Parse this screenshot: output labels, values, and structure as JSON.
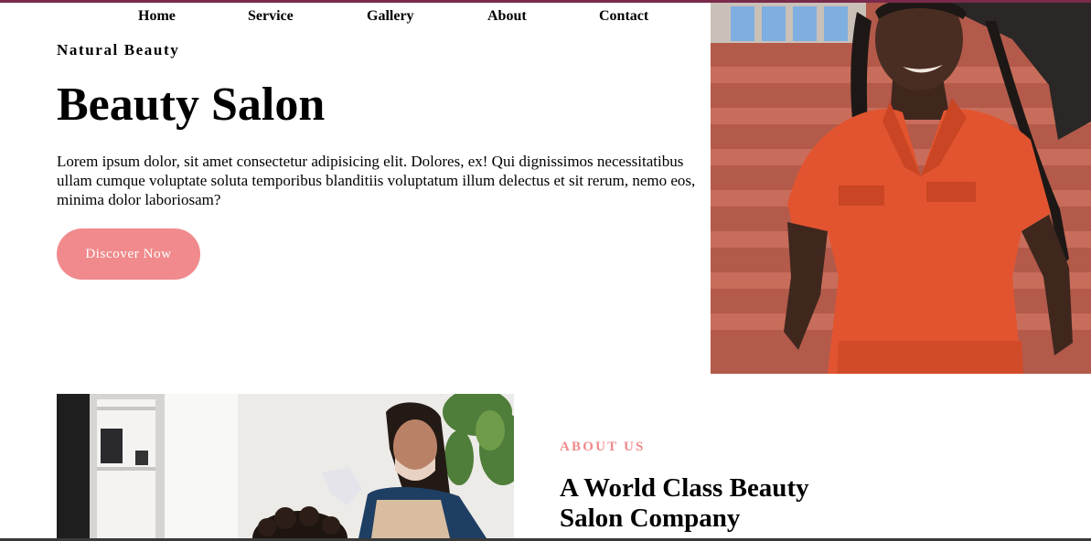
{
  "nav": {
    "items": [
      {
        "label": "Home"
      },
      {
        "label": "Service"
      },
      {
        "label": "Gallery"
      },
      {
        "label": "About"
      },
      {
        "label": "Contact"
      }
    ]
  },
  "hero": {
    "eyebrow": "Natural Beauty",
    "title": "Beauty Salon",
    "text": "Lorem ipsum dolor, sit amet consectetur adipisicing elit. Dolores, ex! Qui dignissimos necessitatibus ullam cumque voluptate soluta temporibus blanditiis voluptatum illum delectus et sit rerum, nemo eos, minima dolor laboriosam?",
    "cta_label": "Discover Now"
  },
  "about": {
    "eyebrow": "ABOUT US",
    "title": "A World Class Beauty Salon Company"
  },
  "colors": {
    "accent": "#f08a8c",
    "top_border": "#7a2a4a",
    "text": "#000000"
  }
}
